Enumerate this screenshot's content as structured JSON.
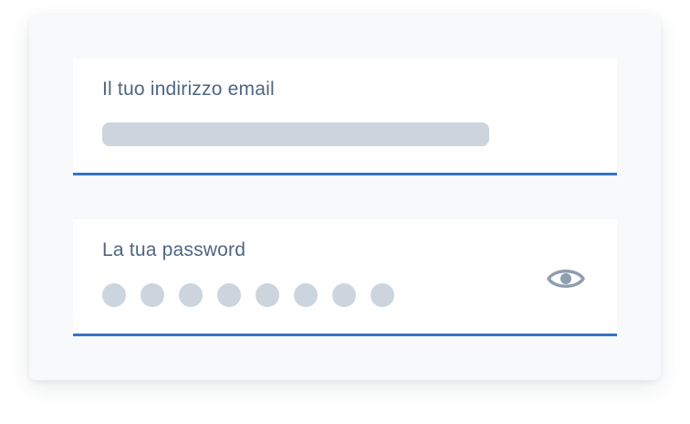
{
  "email_field": {
    "label": "Il tuo indirizzo email"
  },
  "password_field": {
    "label": "La tua password",
    "masked_char_count": 8,
    "toggle_icon": "eye-icon"
  },
  "colors": {
    "accent": "#3573c3",
    "label_text": "#4f6683",
    "placeholder_fill": "#ccd4de",
    "icon": "#8f9db0",
    "card_background": "#f8f9fb"
  }
}
